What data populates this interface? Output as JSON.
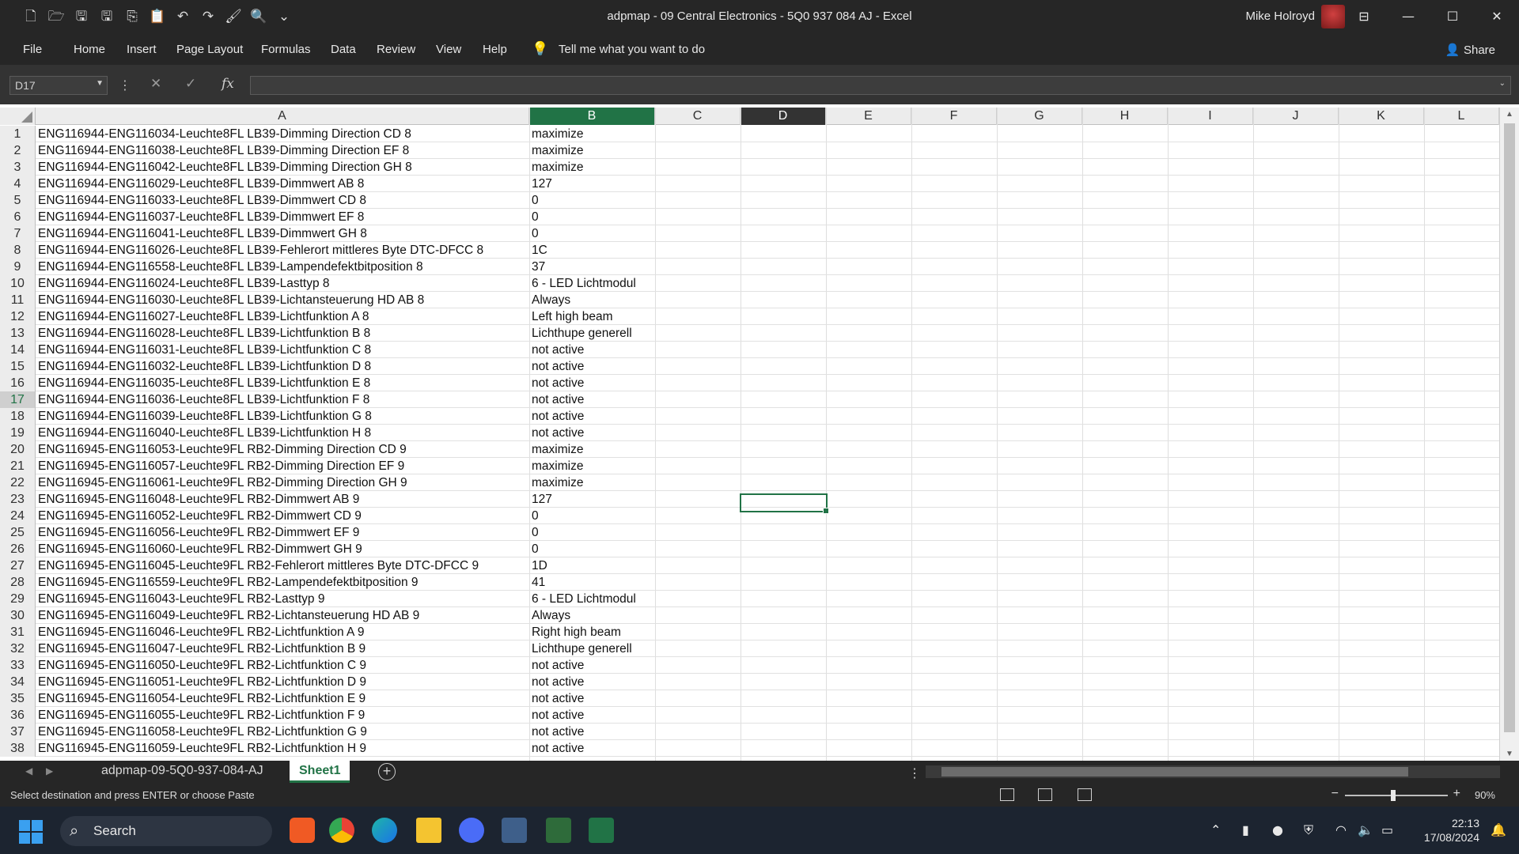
{
  "titlebar": {
    "doc_title": "adpmap - 09 Central Electronics  - 5Q0 937 084 AJ  -  Excel",
    "user": "Mike Holroyd"
  },
  "ribbon_tabs": [
    "File",
    "Home",
    "Insert",
    "Page Layout",
    "Formulas",
    "Data",
    "Review",
    "View",
    "Help"
  ],
  "tell_me": "Tell me what you want to do",
  "share": "Share",
  "formula_bar": {
    "name_box": "D17",
    "fx": "fx",
    "formula": ""
  },
  "columns": [
    "A",
    "B",
    "C",
    "D",
    "E",
    "F",
    "G",
    "H",
    "I",
    "J",
    "K",
    "L"
  ],
  "rows": [
    {
      "n": "1",
      "a": "ENG116944-ENG116034-Leuchte8FL LB39-Dimming Direction CD 8",
      "b": "maximize"
    },
    {
      "n": "2",
      "a": "ENG116944-ENG116038-Leuchte8FL LB39-Dimming Direction EF 8",
      "b": "maximize"
    },
    {
      "n": "3",
      "a": "ENG116944-ENG116042-Leuchte8FL LB39-Dimming Direction GH 8",
      "b": "maximize"
    },
    {
      "n": "4",
      "a": "ENG116944-ENG116029-Leuchte8FL LB39-Dimmwert AB 8",
      "b": "127"
    },
    {
      "n": "5",
      "a": "ENG116944-ENG116033-Leuchte8FL LB39-Dimmwert CD 8",
      "b": "0"
    },
    {
      "n": "6",
      "a": "ENG116944-ENG116037-Leuchte8FL LB39-Dimmwert EF 8",
      "b": "0"
    },
    {
      "n": "7",
      "a": "ENG116944-ENG116041-Leuchte8FL LB39-Dimmwert GH 8",
      "b": "0"
    },
    {
      "n": "8",
      "a": "ENG116944-ENG116026-Leuchte8FL LB39-Fehlerort mittleres Byte DTC-DFCC 8",
      "b": "1C"
    },
    {
      "n": "9",
      "a": "ENG116944-ENG116558-Leuchte8FL LB39-Lampendefektbitposition 8",
      "b": "37"
    },
    {
      "n": "10",
      "a": "ENG116944-ENG116024-Leuchte8FL LB39-Lasttyp 8",
      "b": "6 - LED Lichtmodul"
    },
    {
      "n": "11",
      "a": "ENG116944-ENG116030-Leuchte8FL LB39-Lichtansteuerung HD AB 8",
      "b": "Always"
    },
    {
      "n": "12",
      "a": "ENG116944-ENG116027-Leuchte8FL LB39-Lichtfunktion A 8",
      "b": "Left high beam"
    },
    {
      "n": "13",
      "a": "ENG116944-ENG116028-Leuchte8FL LB39-Lichtfunktion B 8",
      "b": "Lichthupe generell"
    },
    {
      "n": "14",
      "a": "ENG116944-ENG116031-Leuchte8FL LB39-Lichtfunktion C 8",
      "b": "not active"
    },
    {
      "n": "15",
      "a": "ENG116944-ENG116032-Leuchte8FL LB39-Lichtfunktion D 8",
      "b": "not active"
    },
    {
      "n": "16",
      "a": "ENG116944-ENG116035-Leuchte8FL LB39-Lichtfunktion E 8",
      "b": "not active"
    },
    {
      "n": "17",
      "a": "ENG116944-ENG116036-Leuchte8FL LB39-Lichtfunktion F 8",
      "b": "not active"
    },
    {
      "n": "18",
      "a": "ENG116944-ENG116039-Leuchte8FL LB39-Lichtfunktion G 8",
      "b": "not active"
    },
    {
      "n": "19",
      "a": "ENG116944-ENG116040-Leuchte8FL LB39-Lichtfunktion H 8",
      "b": "not active"
    },
    {
      "n": "20",
      "a": "ENG116945-ENG116053-Leuchte9FL RB2-Dimming Direction CD 9",
      "b": "maximize"
    },
    {
      "n": "21",
      "a": "ENG116945-ENG116057-Leuchte9FL RB2-Dimming Direction EF 9",
      "b": "maximize"
    },
    {
      "n": "22",
      "a": "ENG116945-ENG116061-Leuchte9FL RB2-Dimming Direction GH 9",
      "b": "maximize"
    },
    {
      "n": "23",
      "a": "ENG116945-ENG116048-Leuchte9FL RB2-Dimmwert AB 9",
      "b": "127"
    },
    {
      "n": "24",
      "a": "ENG116945-ENG116052-Leuchte9FL RB2-Dimmwert CD 9",
      "b": "0"
    },
    {
      "n": "25",
      "a": "ENG116945-ENG116056-Leuchte9FL RB2-Dimmwert EF 9",
      "b": "0"
    },
    {
      "n": "26",
      "a": "ENG116945-ENG116060-Leuchte9FL RB2-Dimmwert GH 9",
      "b": "0"
    },
    {
      "n": "27",
      "a": "ENG116945-ENG116045-Leuchte9FL RB2-Fehlerort mittleres Byte DTC-DFCC 9",
      "b": "1D"
    },
    {
      "n": "28",
      "a": "ENG116945-ENG116559-Leuchte9FL RB2-Lampendefektbitposition 9",
      "b": "41"
    },
    {
      "n": "29",
      "a": "ENG116945-ENG116043-Leuchte9FL RB2-Lasttyp 9",
      "b": "6 - LED Lichtmodul"
    },
    {
      "n": "30",
      "a": "ENG116945-ENG116049-Leuchte9FL RB2-Lichtansteuerung HD AB 9",
      "b": "Always"
    },
    {
      "n": "31",
      "a": "ENG116945-ENG116046-Leuchte9FL RB2-Lichtfunktion A 9",
      "b": "Right high beam"
    },
    {
      "n": "32",
      "a": "ENG116945-ENG116047-Leuchte9FL RB2-Lichtfunktion B 9",
      "b": "Lichthupe generell"
    },
    {
      "n": "33",
      "a": "ENG116945-ENG116050-Leuchte9FL RB2-Lichtfunktion C 9",
      "b": "not active"
    },
    {
      "n": "34",
      "a": "ENG116945-ENG116051-Leuchte9FL RB2-Lichtfunktion D 9",
      "b": "not active"
    },
    {
      "n": "35",
      "a": "ENG116945-ENG116054-Leuchte9FL RB2-Lichtfunktion E 9",
      "b": "not active"
    },
    {
      "n": "36",
      "a": "ENG116945-ENG116055-Leuchte9FL RB2-Lichtfunktion F 9",
      "b": "not active"
    },
    {
      "n": "37",
      "a": "ENG116945-ENG116058-Leuchte9FL RB2-Lichtfunktion G 9",
      "b": "not active"
    },
    {
      "n": "38",
      "a": "ENG116945-ENG116059-Leuchte9FL RB2-Lichtfunktion H 9",
      "b": "not active"
    }
  ],
  "active_row": "17",
  "sheets": {
    "tab1": "adpmap-09-5Q0-937-084-AJ",
    "tab2": "Sheet1"
  },
  "status": {
    "message": "Select destination and press ENTER or choose Paste",
    "zoom": "90%"
  },
  "taskbar": {
    "search": "Search",
    "time": "22:13",
    "date": "17/08/2024"
  },
  "colors": {
    "excel_green": "#217346"
  }
}
